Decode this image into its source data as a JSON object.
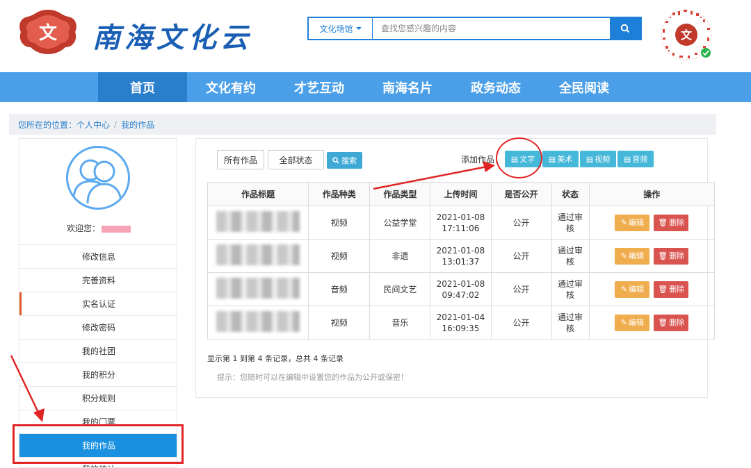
{
  "header": {
    "logo_text": "南海文化云",
    "search": {
      "category": "文化场馆",
      "placeholder": "查找您感兴趣的内容"
    }
  },
  "nav": {
    "items": [
      {
        "label": "首页"
      },
      {
        "label": "文化有约"
      },
      {
        "label": "才艺互动"
      },
      {
        "label": "南海名片"
      },
      {
        "label": "政务动态"
      },
      {
        "label": "全民阅读"
      }
    ]
  },
  "breadcrumb": {
    "prefix": "您所在的位置：个人中心",
    "separator": "/",
    "current": "我的作品"
  },
  "sidebar": {
    "welcome": "欢迎您：",
    "items": [
      {
        "label": "修改信息"
      },
      {
        "label": "完善资料"
      },
      {
        "label": "实名认证"
      },
      {
        "label": "修改密码"
      },
      {
        "label": "我的社团"
      },
      {
        "label": "我的积分"
      },
      {
        "label": "积分规则"
      },
      {
        "label": "我的门票"
      },
      {
        "label": "我的作品"
      },
      {
        "label": "我的统计"
      }
    ]
  },
  "filters": {
    "all_works": "所有作品",
    "all_status": "全部状态",
    "search": "搜索"
  },
  "add_work": {
    "label": "添加作品：",
    "buttons": [
      {
        "label": "文字"
      },
      {
        "label": "美术"
      },
      {
        "label": "视频"
      },
      {
        "label": "音频"
      }
    ]
  },
  "table": {
    "headers": [
      "作品标题",
      "作品种类",
      "作品类型",
      "上传时间",
      "是否公开",
      "状态",
      "操作"
    ],
    "rows": [
      {
        "kind": "视频",
        "type": "公益学堂",
        "date": "2021-01-08",
        "time": "17:11:06",
        "public": "公开",
        "status_1": "通过审",
        "status_2": "核"
      },
      {
        "kind": "视频",
        "type": "非遗",
        "date": "2021-01-08",
        "time": "13:01:37",
        "public": "公开",
        "status_1": "通过审",
        "status_2": "核"
      },
      {
        "kind": "音频",
        "type": "民间文艺",
        "date": "2021-01-08",
        "time": "09:47:02",
        "public": "公开",
        "status_1": "通过审",
        "status_2": "核"
      },
      {
        "kind": "视频",
        "type": "音乐",
        "date": "2021-01-04",
        "time": "16:09:35",
        "public": "公开",
        "status_1": "通过审",
        "status_2": "核"
      }
    ],
    "edit_label": "编辑",
    "delete_label": "删除"
  },
  "summary": "显示第 1 到第 4 条记录，总共 4 条记录",
  "tip": "提示：您随时可以在编辑中设置您的作品为公开或保密！",
  "colors": {
    "brand_blue": "#1e7fd8",
    "nav_blue": "#4a9fe8",
    "annotation_red": "#e02424"
  }
}
